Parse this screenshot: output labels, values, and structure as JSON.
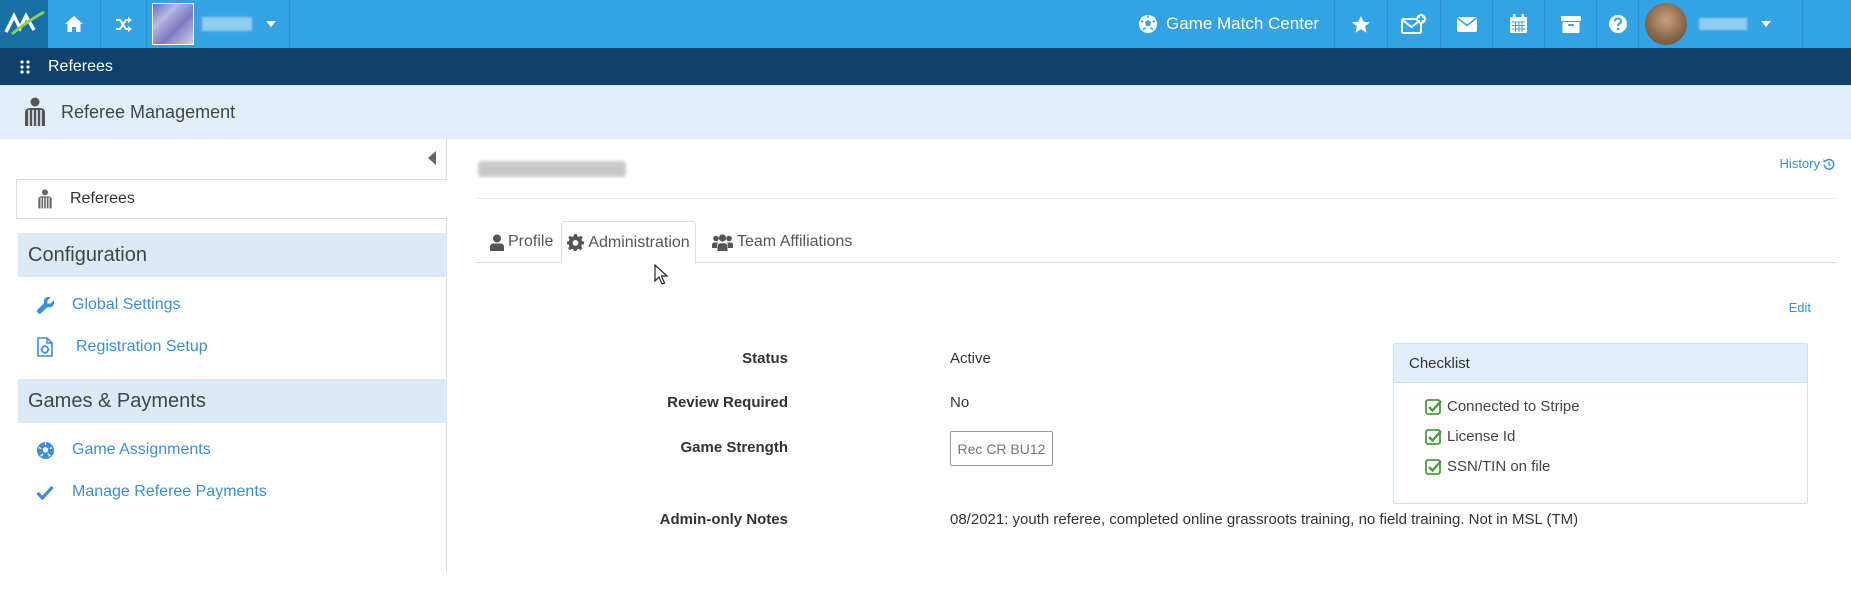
{
  "topbar": {
    "game_match_center_label": "Game Match Center",
    "icons": [
      "logo",
      "home-icon",
      "shuffle-icon",
      "caret-down-icon",
      "soccer-ball-icon",
      "star-icon",
      "envelope-plus-icon",
      "envelope-icon",
      "calendar-icon",
      "archive-icon",
      "question-icon"
    ]
  },
  "subnav": {
    "label": "Referees"
  },
  "section": {
    "title": "Referee Management"
  },
  "sidebar": {
    "referees_label": "Referees",
    "groups": [
      {
        "label": "Configuration",
        "items": [
          {
            "label": "Global Settings"
          },
          {
            "label": "Registration Setup"
          }
        ]
      },
      {
        "label": "Games & Payments",
        "items": [
          {
            "label": "Game Assignments"
          },
          {
            "label": "Manage Referee Payments"
          }
        ]
      }
    ]
  },
  "main": {
    "history_label": "History",
    "tabs": [
      {
        "label": "Profile"
      },
      {
        "label": "Administration",
        "active": true
      },
      {
        "label": "Team Affiliations"
      }
    ],
    "edit_label": "Edit",
    "fields": {
      "status": {
        "label": "Status",
        "value": "Active"
      },
      "review": {
        "label": "Review Required",
        "value": "No"
      },
      "strength": {
        "label": "Game Strength",
        "value": "Rec CR BU12"
      },
      "notes": {
        "label": "Admin-only Notes",
        "value": "08/2021:  youth referee, completed online grassroots training, no field training. Not in MSL (TM)"
      }
    },
    "checklist": {
      "title": "Checklist",
      "items": [
        {
          "label": "Connected to Stripe"
        },
        {
          "label": "License Id"
        },
        {
          "label": "SSN/TIN on file"
        }
      ]
    }
  },
  "colors": {
    "topbar": "#34a3e3",
    "subnav": "#0e416c",
    "accent_link": "#3b8ed8",
    "check": "#4a9a3e"
  }
}
